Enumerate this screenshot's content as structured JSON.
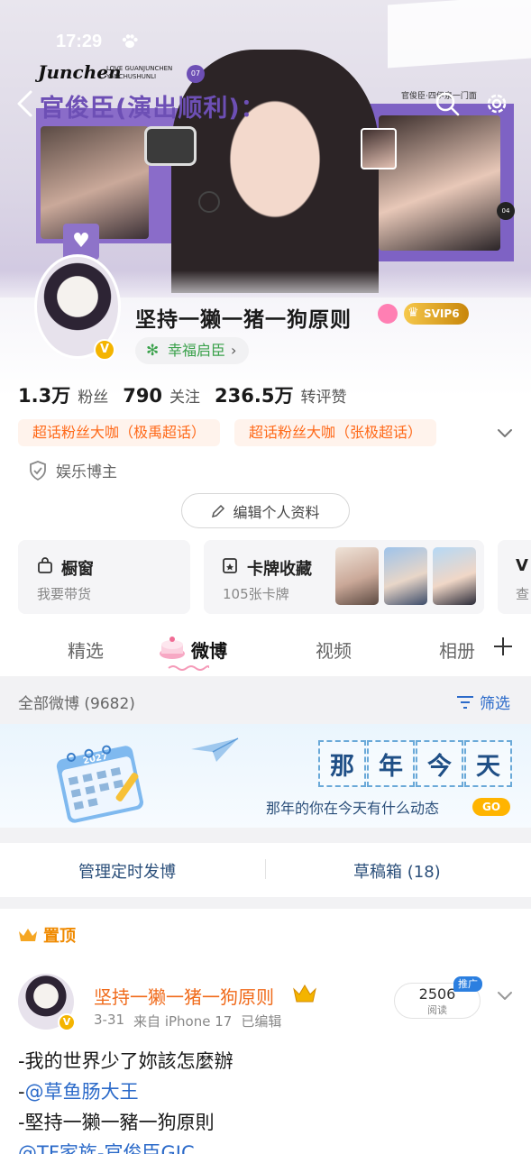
{
  "status_bar": {
    "time": "17:29"
  },
  "banner": {
    "brand": "Junchen",
    "brand_sub_1": "LOVE GUANJUNCHEN",
    "brand_sub_2": "YANCHUSHUNLI",
    "title": "官俊臣(演出顺利)：",
    "badge_07": "07",
    "frame_caption": "官俊臣·四伊泉一门面",
    "badge_04": "04"
  },
  "profile": {
    "username": "坚持一獭一猪一狗原则",
    "svip": "SVIP6",
    "fan_tag": "幸福启臣",
    "fan_tag_chevron": "›",
    "stats": [
      {
        "num": "1.3万",
        "label": "粉丝"
      },
      {
        "num": "790",
        "label": "关注"
      },
      {
        "num": "236.5万",
        "label": "转评赞"
      }
    ],
    "super_tags": [
      "超话粉丝大咖（极禹超话）",
      "超话粉丝大咖（张极超话）"
    ],
    "verification": "娱乐博主",
    "edit_button": "编辑个人资料"
  },
  "cards": {
    "shop": {
      "title": "橱窗",
      "sub": "我要带货"
    },
    "collect": {
      "title": "卡牌收藏",
      "sub": "105张卡牌"
    },
    "more": {
      "sub": "查"
    }
  },
  "tabs": [
    "精选",
    "微博",
    "视频",
    "相册"
  ],
  "active_tab": "微博",
  "filter_bar": {
    "count": "全部微博 (9682)",
    "filter": "筛选"
  },
  "memory": {
    "chars": [
      "那",
      "年",
      "今",
      "天"
    ],
    "subtitle": "那年的你在今天有什么动态",
    "go": "GO",
    "calendar_year": "2027"
  },
  "actions": {
    "left": "管理定时发博",
    "right": "草稿箱 (18)"
  },
  "post": {
    "pinned": "置顶",
    "author": "坚持一獭一猪一狗原则",
    "date": "3-31",
    "source": "来自 iPhone 17",
    "edited": "已编辑",
    "reads": "2506",
    "reads_label": "阅读",
    "promo": "推广",
    "lines": [
      {
        "prefix": "-",
        "text": "我的世界少了妳該怎麼辦",
        "mention": ""
      },
      {
        "prefix": "-",
        "text": "",
        "mention": "@草鱼肠大王"
      },
      {
        "prefix": "-",
        "text": "堅持一獭一豬一狗原則",
        "mention": ""
      },
      {
        "prefix": "",
        "text": "",
        "mention": "@TF家族-官俊臣GJC"
      }
    ]
  },
  "colors": {
    "accent_blue": "#2b6ac9",
    "orange": "#ff6a1a",
    "gold": "#f4b400",
    "purple": "#6d4fb5"
  }
}
